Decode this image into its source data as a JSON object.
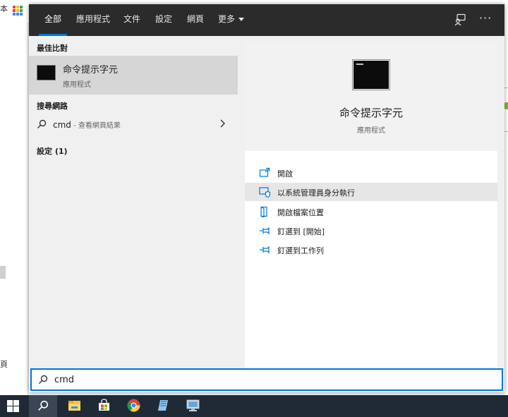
{
  "background": {
    "left_char_top": "本",
    "left_char_bottom": "頁"
  },
  "tabs": [
    {
      "label": "全部",
      "active": true
    },
    {
      "label": "應用程式"
    },
    {
      "label": "文件"
    },
    {
      "label": "設定"
    },
    {
      "label": "網頁"
    },
    {
      "label": "更多"
    }
  ],
  "top_icons": [
    "feedback-icon",
    "more-options-icon"
  ],
  "top_ellipsis": "···",
  "best_match": {
    "header": "最佳比對",
    "title": "命令提示字元",
    "subtitle": "應用程式",
    "icon": "cmd-icon"
  },
  "web_search": {
    "header": "搜尋網路",
    "query": "cmd",
    "suffix": " - 查看網頁結果"
  },
  "settings_group": {
    "header": "設定 (1)"
  },
  "preview": {
    "title": "命令提示字元",
    "subtitle": "應用程式",
    "actions": [
      {
        "label": "開啟",
        "icon": "open-icon"
      },
      {
        "label": "以系統管理員身分執行",
        "icon": "shield-icon",
        "highlighted": true
      },
      {
        "label": "開啟檔案位置",
        "icon": "file-location-icon"
      },
      {
        "label": "釘選到 [開始]",
        "icon": "pin-icon"
      },
      {
        "label": "釘選到工作列",
        "icon": "pin-icon"
      }
    ]
  },
  "search_box": {
    "value": "cmd",
    "icon": "search-icon"
  },
  "taskbar": {
    "items": [
      "windows-start-icon",
      "search-icon",
      "file-explorer-icon",
      "microsoft-store-icon",
      "chrome-icon",
      "notepad-app-icon",
      "remote-desktop-icon"
    ]
  },
  "colors": {
    "accent": "#0078d7",
    "topbar": "#2b2b2b",
    "taskbar": "#1f2a36",
    "highlight": "#d6d6d6"
  }
}
